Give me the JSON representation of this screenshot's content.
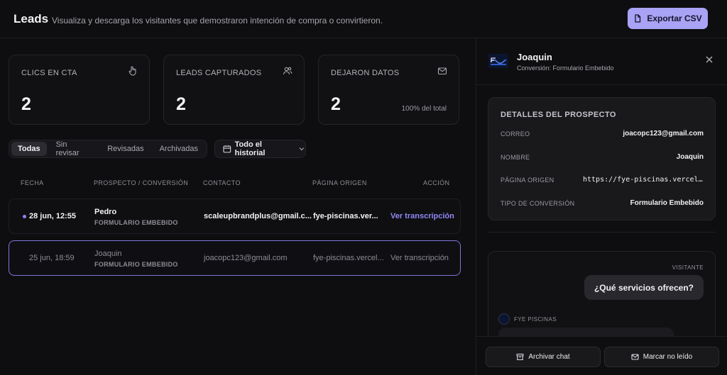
{
  "header": {
    "title": "Leads",
    "subtitle": "Visualiza y descarga los visitantes que demostraron intención de compra o convirtieron.",
    "export_label": "Exportar CSV"
  },
  "stats": [
    {
      "label": "CLICS EN CTA",
      "value": "2",
      "icon": "hand-pointer-icon"
    },
    {
      "label": "LEADS CAPTURADOS",
      "value": "2",
      "icon": "users-icon"
    },
    {
      "label": "DEJARON DATOS",
      "value": "2",
      "note": "100% del total",
      "icon": "mail-icon"
    }
  ],
  "filters": {
    "tabs": [
      "Todas",
      "Sin revisar",
      "Revisadas",
      "Archivadas"
    ],
    "active_tab": "Todas",
    "history_label": "Todo el historial"
  },
  "table": {
    "columns": [
      "FECHA",
      "PROSPECTO / CONVERSIÓN",
      "CONTACTO",
      "PÁGINA ORIGEN",
      "ACCIÓN"
    ],
    "rows": [
      {
        "date": "28 jun, 12:55",
        "name": "Pedro",
        "conversion": "FORMULARIO EMBEBIDO",
        "contact": "scaleupbrandplus@gmail.c...",
        "origin": "fye-piscinas.ver...",
        "action": "Ver transcripción",
        "unread": true
      },
      {
        "date": "25 jun, 18:59",
        "name": "Joaquin",
        "conversion": "FORMULARIO EMBEBIDO",
        "contact": "joacopc123@gmail.com",
        "origin": "fye-piscinas.vercel...",
        "action": "Ver transcripción",
        "unread": false
      }
    ]
  },
  "panel": {
    "name": "Joaquin",
    "conversion": "Conversión: Formulario Embebido",
    "details": {
      "title": "DETALLES DEL PROSPECTO",
      "fields": [
        {
          "label": "CORREO",
          "value": "joacopc123@gmail.com"
        },
        {
          "label": "NOMBRE",
          "value": "Joaquin"
        },
        {
          "label": "PÁGINA ORIGEN",
          "value": "https://fye-piscinas.vercel.a..."
        },
        {
          "label": "TIPO DE CONVERSIÓN",
          "value": "Formulario Embebido"
        }
      ]
    },
    "chat": {
      "visitor_label": "VISITANTE",
      "visitor_message": "¿Qué servicios ofrecen?",
      "bot_label": "FYE PISCINAS"
    },
    "archive_label": "Archivar chat",
    "unread_label": "Marcar no leído"
  },
  "colors": {
    "accent": "#a8a3f4",
    "link": "#8f88f5",
    "selected_border": "#7d76d9"
  }
}
